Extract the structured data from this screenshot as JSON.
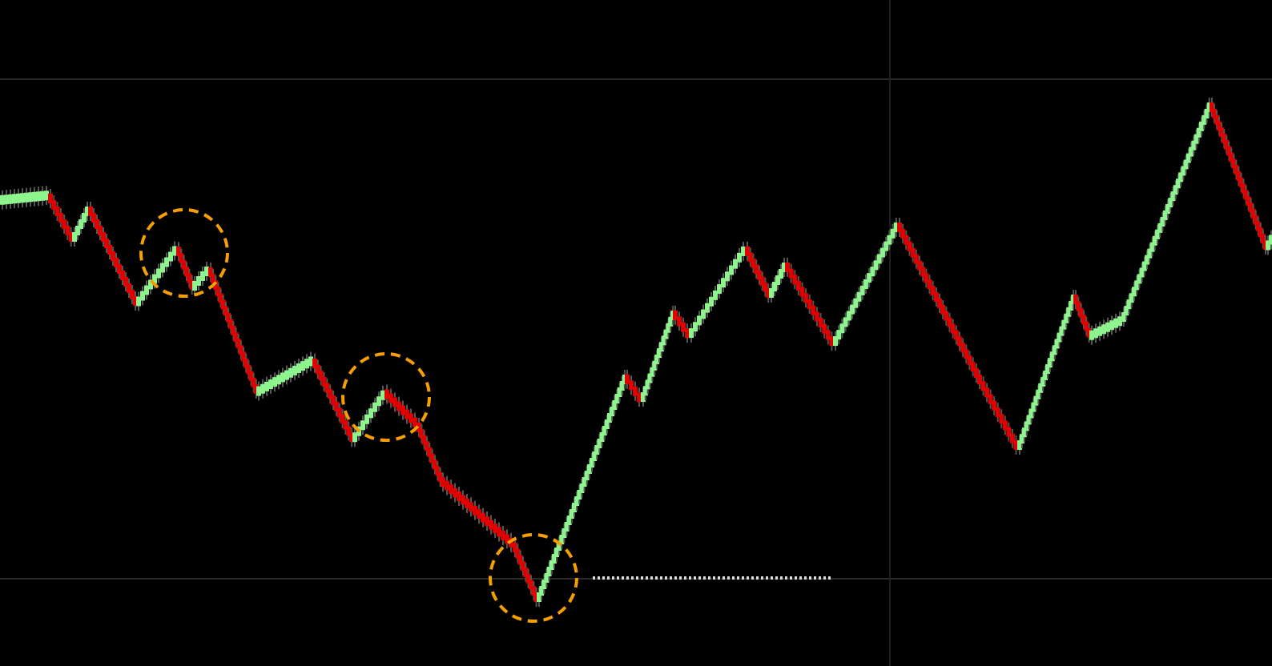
{
  "chart": {
    "kind": "renko"
  }
}
